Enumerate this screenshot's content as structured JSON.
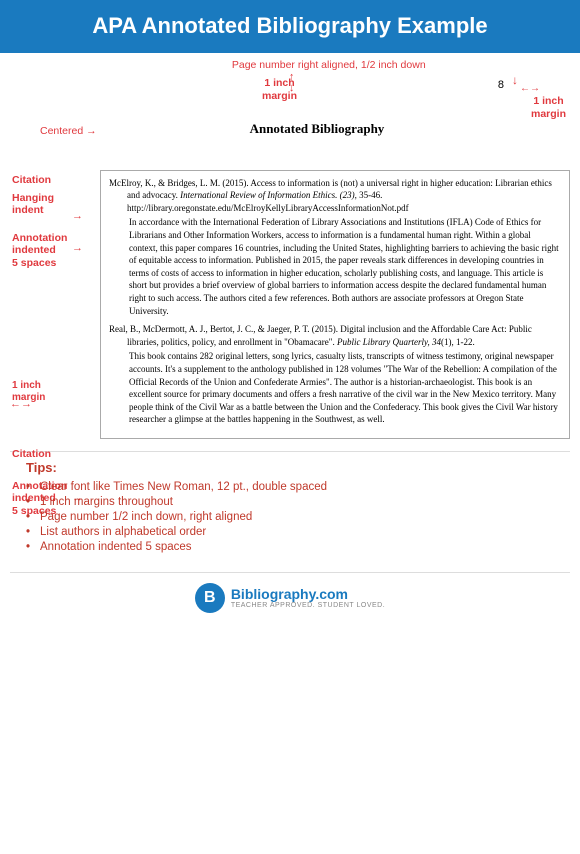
{
  "header": {
    "title": "APA Annotated Bibliography Example"
  },
  "top_diagram": {
    "page_number_label": "Page number right aligned, 1/2 inch down",
    "one_inch_margin_label": "1 inch\nmargin",
    "right_margin_label": "1 inch\nmargin",
    "centered_label": "Centered",
    "annotated_bib_title": "Annotated Bibliography"
  },
  "left_labels": {
    "citation_1": "Citation",
    "hanging_indent": "Hanging\nindent",
    "annotation_1": "Annotation\nindented\n5 spaces",
    "inch_margin": "1 inch\nmargin",
    "citation_2": "Citation",
    "annotation_2": "Annotation\nindented\n5 spaces"
  },
  "citations": [
    {
      "ref": "McElroy, K., & Bridges, L. M. (2015). Access to information is (not) a universal right in higher education: Librarian ethics and advocacy. International Review of Information Ethics. (23), 35-46. http://library.oregonstate.edu/McElroyKellyLibraryAccessInformationNot.pdf",
      "annotation": "In accordance with the International Federation of Library Associations and Institutions (IFLA) Code of Ethics for Librarians and Other Information Workers, access to information is a fundamental human right.  Within a global context, this paper compares 16 countries, including the United States, highlighting barriers to achieving the basic right of equitable access to information. Published in 2015, the paper reveals stark differences in developing countries in terms of costs of access to information in higher education, scholarly publishing costs, and language. This article is short but provides a brief overview of global barriers to information access despite the declared fundamental human right to such access. The authors cited a few references. Both authors are associate professors at Oregon State University."
    },
    {
      "ref": "Real, B., McDermott, A. J., Bertot, J. C., & Jaeger, P. T. (2015). Digital inclusion and the Affordable Care Act: Public libraries, politics, policy, and enrollment in \"Obamacare\". Public Library Quarterly, 34(1), 1-22.",
      "annotation": "This book contains 282 original letters, song lyrics, casualty lists, transcripts of witness testimony, original newspaper accounts. It's a supplement to the anthology published in 128 volumes \"The War of the Rebellion: A compilation of the Official Records of the Union and Confederate Armies\". The author is a historian-archaeologist. This book is an excellent source for primary documents and offers a fresh narrative of the civil war in the New Mexico territory. Many people think of the Civil War as a battle between the Union and the Confederacy. This book gives the Civil War history researcher a glimpse at the battles happening in the Southwest, as well."
    }
  ],
  "tips": {
    "title": "Tips:",
    "items": [
      "Clear font like Times New Roman, 12 pt., double spaced",
      "1 inch margins throughout",
      "Page number 1/2 inch down, right aligned",
      "List authors in alphabetical order",
      "Annotation indented 5 spaces"
    ]
  },
  "footer": {
    "logo_letter": "B",
    "brand_name": "Bibliography.com",
    "tagline": "TEACHER APPROVED. STUDENT LOVED."
  }
}
